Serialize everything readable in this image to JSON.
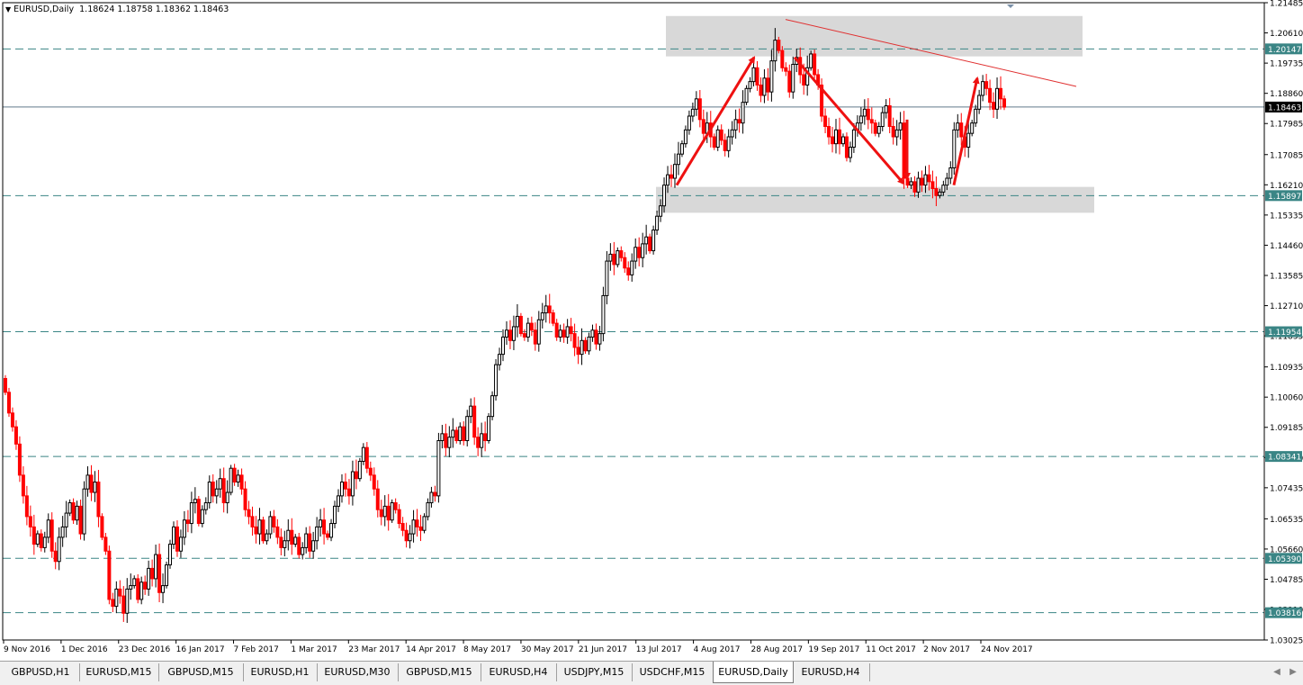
{
  "header": {
    "symbol_tf": "EURUSD,Daily",
    "ohlc": "1.18624 1.18758 1.18362 1.18463"
  },
  "colors": {
    "bull": "#000000",
    "bear": "#ff0000",
    "hline": "#3a8585",
    "current_price_line": "#607a8a",
    "zone": "#d8d8d8",
    "arrow": "#ee1111",
    "trendline": "#e03030"
  },
  "chart_data": {
    "type": "candlestick",
    "symbol": "EURUSD",
    "timeframe": "Daily",
    "ylim": [
      1.03025,
      1.21485
    ],
    "y_ticks": [
      "1.21485",
      "1.20610",
      "1.19735",
      "1.18860",
      "1.17985",
      "1.17085",
      "1.16210",
      "1.15335",
      "1.14460",
      "1.13585",
      "1.12710",
      "1.11835",
      "1.10935",
      "1.10060",
      "1.09185",
      "1.08310",
      "1.07435",
      "1.06535",
      "1.05660",
      "1.04785",
      "1.03910",
      "1.03025"
    ],
    "x_labels": [
      "9 Nov 2016",
      "1 Dec 2016",
      "23 Dec 2016",
      "16 Jan 2017",
      "7 Feb 2017",
      "1 Mar 2017",
      "23 Mar 2017",
      "14 Apr 2017",
      "8 May 2017",
      "30 May 2017",
      "21 Jun 2017",
      "13 Jul 2017",
      "4 Aug 2017",
      "28 Aug 2017",
      "19 Sep 2017",
      "11 Oct 2017",
      "2 Nov 2017",
      "24 Nov 2017"
    ],
    "horizontal_levels": [
      1.20147,
      1.15897,
      1.11954,
      1.08341,
      1.0539,
      1.03816
    ],
    "current_price": 1.18463,
    "closes": [
      1.102,
      1.096,
      1.092,
      1.087,
      1.078,
      1.072,
      1.066,
      1.063,
      1.058,
      1.061,
      1.057,
      1.06,
      1.065,
      1.056,
      1.053,
      1.06,
      1.063,
      1.067,
      1.07,
      1.065,
      1.069,
      1.061,
      1.074,
      1.078,
      1.073,
      1.076,
      1.066,
      1.06,
      1.056,
      1.042,
      1.04,
      1.045,
      1.043,
      1.038,
      1.045,
      1.046,
      1.048,
      1.042,
      1.047,
      1.045,
      1.051,
      1.048,
      1.055,
      1.044,
      1.046,
      1.052,
      1.058,
      1.063,
      1.056,
      1.06,
      1.065,
      1.064,
      1.07,
      1.071,
      1.064,
      1.068,
      1.07,
      1.076,
      1.072,
      1.074,
      1.077,
      1.07,
      1.073,
      1.08,
      1.076,
      1.078,
      1.074,
      1.068,
      1.066,
      1.063,
      1.061,
      1.065,
      1.059,
      1.061,
      1.066,
      1.063,
      1.06,
      1.057,
      1.059,
      1.062,
      1.058,
      1.06,
      1.055,
      1.057,
      1.061,
      1.056,
      1.059,
      1.063,
      1.065,
      1.061,
      1.06,
      1.064,
      1.069,
      1.072,
      1.076,
      1.074,
      1.072,
      1.079,
      1.077,
      1.082,
      1.086,
      1.08,
      1.078,
      1.074,
      1.068,
      1.066,
      1.069,
      1.065,
      1.07,
      1.068,
      1.064,
      1.062,
      1.059,
      1.061,
      1.065,
      1.063,
      1.062,
      1.066,
      1.07,
      1.073,
      1.072,
      1.088,
      1.09,
      1.086,
      1.089,
      1.091,
      1.088,
      1.092,
      1.088,
      1.095,
      1.098,
      1.089,
      1.086,
      1.09,
      1.088,
      1.095,
      1.101,
      1.11,
      1.113,
      1.118,
      1.12,
      1.117,
      1.121,
      1.124,
      1.119,
      1.118,
      1.122,
      1.12,
      1.116,
      1.123,
      1.125,
      1.127,
      1.125,
      1.122,
      1.118,
      1.12,
      1.118,
      1.121,
      1.119,
      1.115,
      1.113,
      1.117,
      1.114,
      1.118,
      1.12,
      1.116,
      1.119,
      1.13,
      1.14,
      1.142,
      1.139,
      1.143,
      1.141,
      1.138,
      1.136,
      1.14,
      1.144,
      1.141,
      1.145,
      1.147,
      1.143,
      1.149,
      1.153,
      1.156,
      1.162,
      1.165,
      1.164,
      1.168,
      1.171,
      1.174,
      1.178,
      1.182,
      1.184,
      1.187,
      1.181,
      1.177,
      1.18,
      1.176,
      1.173,
      1.178,
      1.175,
      1.172,
      1.176,
      1.178,
      1.181,
      1.18,
      1.186,
      1.19,
      1.192,
      1.196,
      1.191,
      1.188,
      1.193,
      1.189,
      1.198,
      1.204,
      1.201,
      1.196,
      1.195,
      1.189,
      1.197,
      1.199,
      1.194,
      1.191,
      1.196,
      1.2,
      1.194,
      1.191,
      1.182,
      1.179,
      1.176,
      1.174,
      1.178,
      1.174,
      1.176,
      1.17,
      1.173,
      1.178,
      1.18,
      1.182,
      1.184,
      1.181,
      1.18,
      1.177,
      1.179,
      1.183,
      1.185,
      1.179,
      1.176,
      1.178,
      1.18,
      1.164,
      1.162,
      1.163,
      1.16,
      1.164,
      1.162,
      1.165,
      1.163,
      1.161,
      1.159,
      1.16,
      1.162,
      1.164,
      1.167,
      1.178,
      1.18,
      1.176,
      1.173,
      1.177,
      1.18,
      1.184,
      1.188,
      1.192,
      1.19,
      1.186,
      1.184,
      1.19,
      1.187,
      1.1846
    ]
  },
  "annotations": {
    "zones": [
      "resistance-zone",
      "support-zone"
    ],
    "arrows": 4,
    "trendline": "descending"
  },
  "tabs": [
    {
      "label": "GBPUSD,H1"
    },
    {
      "label": "EURUSD,M15"
    },
    {
      "label": "GBPUSD,M15"
    },
    {
      "label": "EURUSD,H1"
    },
    {
      "label": "EURUSD,M30"
    },
    {
      "label": "GBPUSD,M15"
    },
    {
      "label": "EURUSD,H4"
    },
    {
      "label": "USDJPY,M15"
    },
    {
      "label": "USDCHF,M15"
    },
    {
      "label": "EURUSD,Daily",
      "active": true
    },
    {
      "label": "EURUSD,H4"
    }
  ]
}
